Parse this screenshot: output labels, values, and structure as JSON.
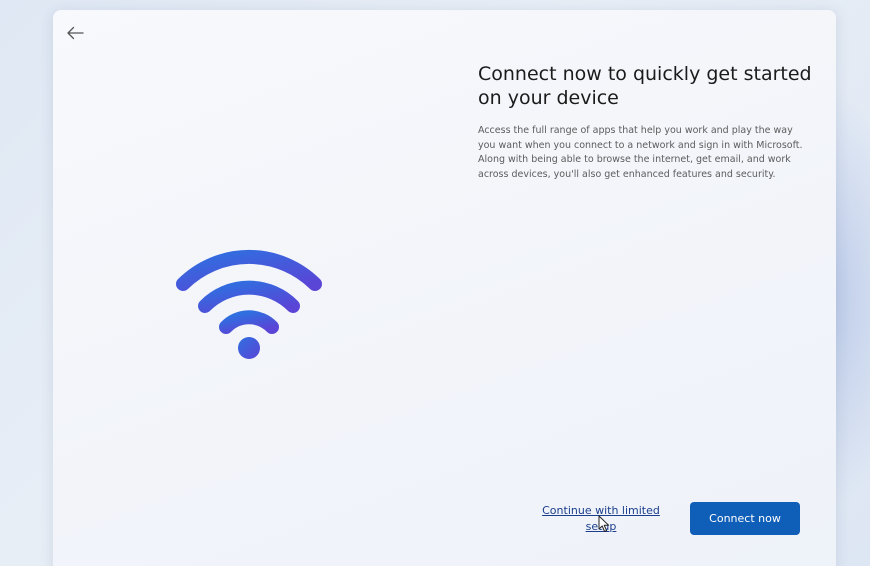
{
  "header": {
    "back_icon": "arrow-left-icon"
  },
  "illustration": {
    "icon": "wifi-icon",
    "gradient_start": "#2f6fe0",
    "gradient_end": "#5a45d6"
  },
  "content": {
    "title": "Connect now to quickly get started on your device",
    "description": "Access the full range of apps that help you work and play the way you want when you connect to a network and sign in with Microsoft. Along with being able to browse the internet, get email, and work across devices, you'll also get enhanced features and security."
  },
  "footer": {
    "limited_setup_label": "Continue with limited setup",
    "connect_now_label": "Connect now"
  },
  "colors": {
    "accent": "#0f5fb8",
    "link": "#1a3e8c"
  }
}
